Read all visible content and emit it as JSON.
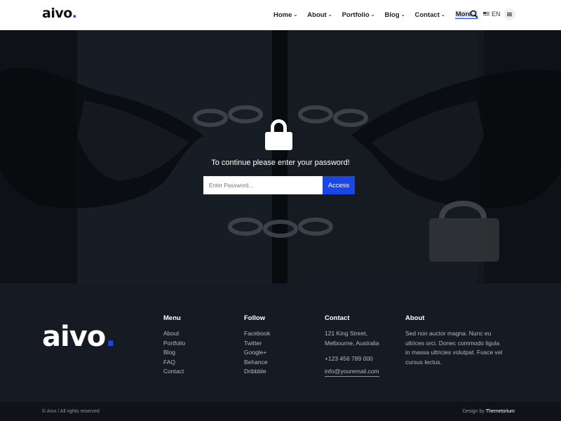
{
  "header": {
    "logo": "aivo",
    "logo_dot": ".",
    "nav": [
      {
        "label": "Home"
      },
      {
        "label": "About"
      },
      {
        "label": "Portfolio"
      },
      {
        "label": "Blog"
      },
      {
        "label": "Contact"
      },
      {
        "label": "More"
      }
    ],
    "language": "EN"
  },
  "hero": {
    "prompt": "To continue please enter your password!",
    "password_placeholder": "Enter Password...",
    "access_label": "Access"
  },
  "footer": {
    "logo": "aivo",
    "logo_dot": ".",
    "menu": {
      "title": "Menu",
      "items": [
        "About",
        "Portfolio",
        "Blog",
        "FAQ",
        "Contact"
      ]
    },
    "follow": {
      "title": "Follow",
      "items": [
        "Facebook",
        "Twitter",
        "Google+",
        "Behance",
        "Dribbble"
      ]
    },
    "contact": {
      "title": "Contact",
      "address_line1": "121 King Street,",
      "address_line2": "Melbourne, Australia",
      "phone": "+123 456 789 000",
      "email": "info@youremail.com"
    },
    "about": {
      "title": "About",
      "lines": [
        "Sed non auctor magna. Nunc eu",
        "ultrices orci. Donec commodo ligula",
        "in massa ultricies volutpat. Fusce vel",
        "cursus lectus."
      ]
    },
    "copyright": "© Aivo / All rights reserved",
    "design_by_label": "Design by",
    "design_by_name": "Themetorium"
  },
  "colors": {
    "accent": "#1a45e8",
    "footer_bg": "#161a23",
    "header_bg": "#ffffff"
  },
  "icons": [
    "search-icon",
    "flag-icon",
    "menu-icon",
    "lock-icon",
    "chevron-down-icon"
  ]
}
